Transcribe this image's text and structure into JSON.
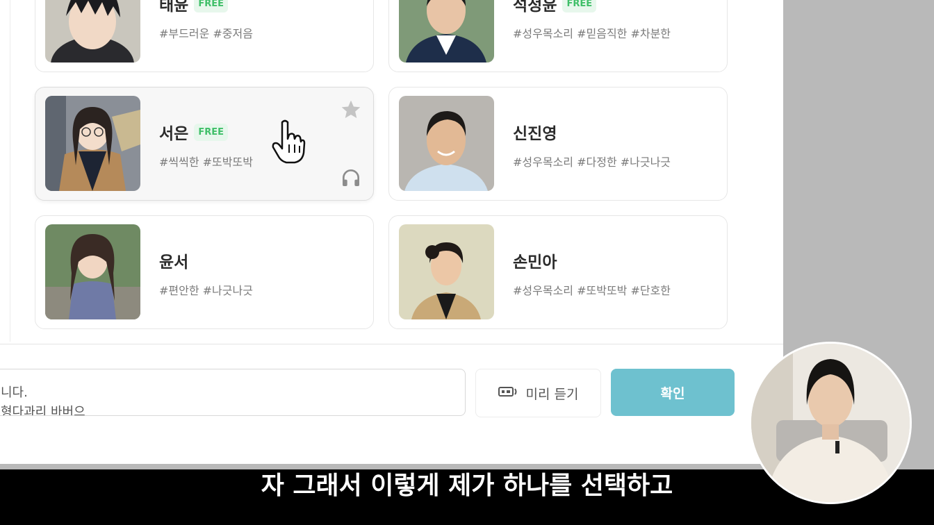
{
  "voice_list": {
    "items": [
      {
        "id": "taeun",
        "name": "태윤",
        "badge": "FREE",
        "tags": "#부드러운 #중저음"
      },
      {
        "id": "seokjeongyun",
        "name": "석정윤",
        "badge": "FREE",
        "tags": "#성우목소리 #믿음직한 #차분한"
      },
      {
        "id": "seoeun",
        "name": "서은",
        "badge": "FREE",
        "tags": "#씩씩한 #또박또박"
      },
      {
        "id": "sinjinyeong",
        "name": "신진영",
        "badge": "",
        "tags": "#성우목소리 #다정한 #나긋나긋"
      },
      {
        "id": "yunseo",
        "name": "윤서",
        "badge": "",
        "tags": "#편안한 #나긋나긋"
      },
      {
        "id": "sonmina",
        "name": "손민아",
        "badge": "",
        "tags": "#성우목소리 #또박또박 #단호한"
      }
    ],
    "selected": "seoeun"
  },
  "footer": {
    "input_text": "니다.",
    "input_text_line2": "형다과리 바버으",
    "preview_label": "미리 듣기",
    "confirm_label": "확인"
  },
  "subtitle": "자 그래서 이렇게 제가 하나를 선택하고",
  "icons": {
    "star": "star-icon",
    "headphone": "headphone-icon",
    "speaker": "speaker-icon",
    "cursor": "hand-cursor-icon"
  },
  "colors": {
    "free_badge_text": "#3fbf68",
    "free_badge_bg": "#e7f7ec",
    "confirm_bg": "#6ec1cf",
    "subtitle_bg": "#000000"
  }
}
